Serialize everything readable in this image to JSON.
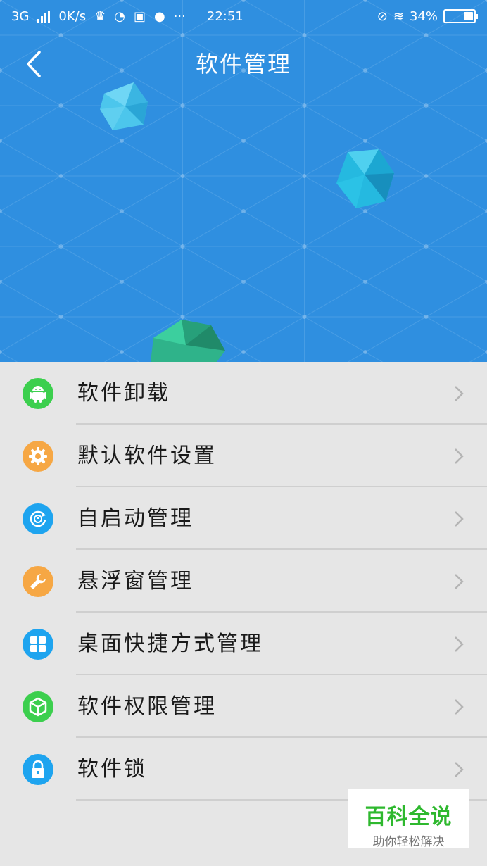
{
  "status": {
    "network": "3G",
    "speed": "0K/s",
    "time": "22:51",
    "battery": "34%",
    "battery_level": 0.34
  },
  "header": {
    "title": "软件管理"
  },
  "menu": {
    "items": [
      {
        "label": "软件卸载",
        "icon": "android-icon",
        "color": "#3ccf4e"
      },
      {
        "label": "默认软件设置",
        "icon": "gear-icon",
        "color": "#f6a744"
      },
      {
        "label": "自启动管理",
        "icon": "power-cycle-icon",
        "color": "#1ea4ef"
      },
      {
        "label": "悬浮窗管理",
        "icon": "wrench-icon",
        "color": "#f6a744"
      },
      {
        "label": "桌面快捷方式管理",
        "icon": "grid-icon",
        "color": "#1ea4ef"
      },
      {
        "label": "软件权限管理",
        "icon": "cube-icon",
        "color": "#3ccf4e"
      },
      {
        "label": "软件锁",
        "icon": "lock-icon",
        "color": "#1ea4ef"
      }
    ]
  },
  "watermark": {
    "brand": "百科全说",
    "tagline": "助你轻松解决"
  },
  "colors": {
    "header_bg": "#2f8fe0",
    "list_bg": "#e6e6e6",
    "divider": "#cfcfcf"
  }
}
